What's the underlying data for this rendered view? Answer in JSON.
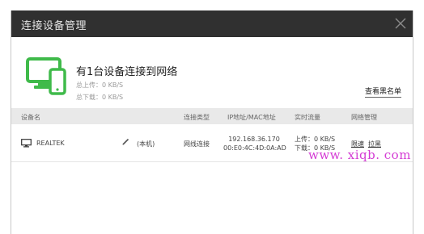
{
  "window": {
    "title": "连接设备管理"
  },
  "summary": {
    "headline": "有1台设备连接到网络",
    "upload": "总上传：0 KB/S",
    "download": "总下载：0 KB/S",
    "blacklist_link": "查看黑名单",
    "accent_color": "#3fba4a"
  },
  "table": {
    "headers": {
      "device": "设备名",
      "conn_type": "连接类型",
      "address": "IP地址/MAC地址",
      "traffic": "实时流量",
      "manage": "网络管理"
    },
    "rows": [
      {
        "name": "REALTEK",
        "local_tag": "(本机)",
        "conn_type": "网线连接",
        "ip": "192.168.36.170",
        "mac": "00:E0:4C:4D:0A:AD",
        "upload": "上传：0 KB/S",
        "download": "下载：0 KB/S",
        "limit_action": "限速",
        "block_action": "拉黑"
      }
    ]
  },
  "watermark": "www. xiqb. com"
}
